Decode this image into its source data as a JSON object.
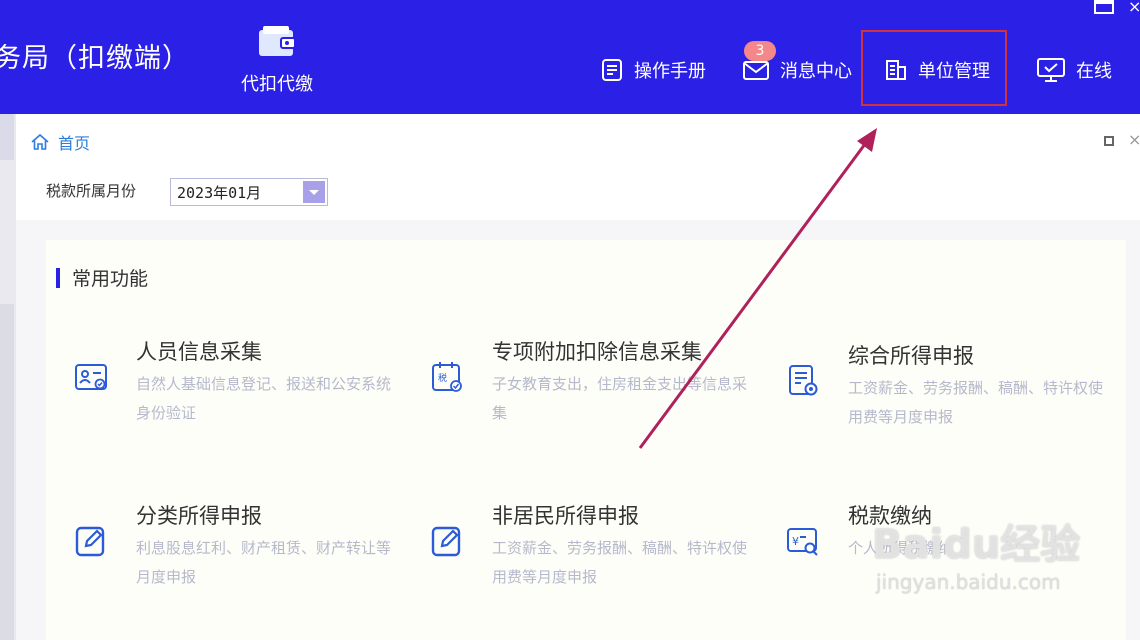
{
  "header": {
    "app_title": "务局（扣缴端）",
    "agent_label": "代扣代缴",
    "nav": {
      "manual": "操作手册",
      "messages": "消息中心",
      "message_count": "3",
      "unit": "单位管理",
      "online": "在线"
    },
    "window_close": "×"
  },
  "tab": {
    "home": "首页",
    "close": "×"
  },
  "filter": {
    "month_label": "税款所属月份",
    "month_value": "2023年01月"
  },
  "section": {
    "title": "常用功能"
  },
  "cards": [
    {
      "title": "人员信息采集",
      "desc": "自然人基础信息登记、报送和公安系统身份验证",
      "icon": "person-id-icon"
    },
    {
      "title": "专项附加扣除信息采集",
      "desc": "子女教育支出，住房租金支出等信息采集",
      "icon": "tax-calendar-icon"
    },
    {
      "title": "综合所得申报",
      "desc": "工资薪金、劳务报酬、稿酬、特许权使用费等月度申报",
      "icon": "document-check-icon"
    },
    {
      "title": "分类所得申报",
      "desc": "利息股息红利、财产租赁、财产转让等月度申报",
      "icon": "edit-icon"
    },
    {
      "title": "非居民所得申报",
      "desc": "工资薪金、劳务报酬、稿酬、特许权使用费等月度申报",
      "icon": "edit-icon"
    },
    {
      "title": "税款缴纳",
      "desc": "个人所得税缴纳",
      "icon": "yuan-search-icon"
    }
  ],
  "watermark": {
    "main": "Baidu经验",
    "sub": "jingyan.baidu.com"
  },
  "colors": {
    "header_bg": "#2b20e6",
    "accent": "#2b20e6",
    "highlight_box": "#d0323e",
    "arrow": "#b0205a",
    "badge": "#f4878a",
    "link": "#2d7de0"
  }
}
